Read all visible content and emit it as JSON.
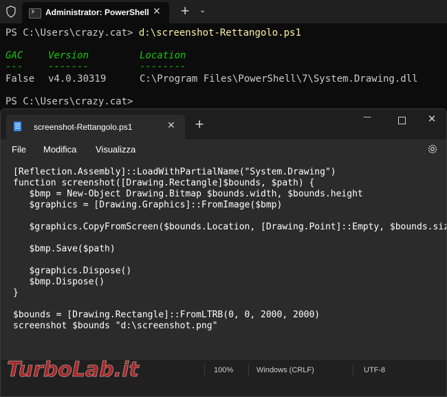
{
  "terminal": {
    "tab_title": "Administrator: PowerShell",
    "close_glyph": "✕",
    "new_tab_glyph": "+",
    "dropdown_glyph": "⌄",
    "line1_prompt": "PS C:\\Users\\crazy.cat> ",
    "line1_command": "d:\\screenshot-Rettangolo.ps1",
    "headers": {
      "gac": "GAC",
      "version": "Version",
      "location": "Location"
    },
    "header_underlines": {
      "gac": "---",
      "version": "-------",
      "location": "--------"
    },
    "row": {
      "gac": "False",
      "version": "v4.0.30319",
      "location": "C:\\Program Files\\PowerShell\\7\\System.Drawing.dll"
    },
    "line_last_prompt": "PS C:\\Users\\crazy.cat>"
  },
  "notepad": {
    "tab_title": "screenshot-Rettangolo.ps1",
    "close_glyph": "✕",
    "new_tab_glyph": "+",
    "minimize_glyph": "—",
    "close_window_glyph": "✕",
    "menu": {
      "file": "File",
      "edit": "Modifica",
      "view": "Visualizza"
    },
    "code_lines": [
      "[Reflection.Assembly]::LoadWithPartialName(\"System.Drawing\")",
      "function screenshot([Drawing.Rectangle]$bounds, $path) {",
      "   $bmp = New-Object Drawing.Bitmap $bounds.width, $bounds.height",
      "   $graphics = [Drawing.Graphics]::FromImage($bmp)",
      "",
      "   $graphics.CopyFromScreen($bounds.Location, [Drawing.Point]::Empty, $bounds.size)",
      "",
      "   $bmp.Save($path)",
      "",
      "   $graphics.Dispose()",
      "   $bmp.Dispose()",
      "}",
      "",
      "$bounds = [Drawing.Rectangle]::FromLTRB(0, 0, 2000, 2000)",
      "screenshot $bounds \"d:\\screenshot.png\""
    ],
    "status": {
      "zoom": "100%",
      "line_ending": "Windows (CRLF)",
      "encoding": "UTF-8"
    }
  },
  "watermark": {
    "text": "TurboLab.it"
  },
  "colors": {
    "terminal_bg": "#0c0c0c",
    "header_green": "#16c60c",
    "command_yellow": "#f9f1a5",
    "editor_bg": "#2b2b2b",
    "accent_blue": "#3b8eea"
  }
}
